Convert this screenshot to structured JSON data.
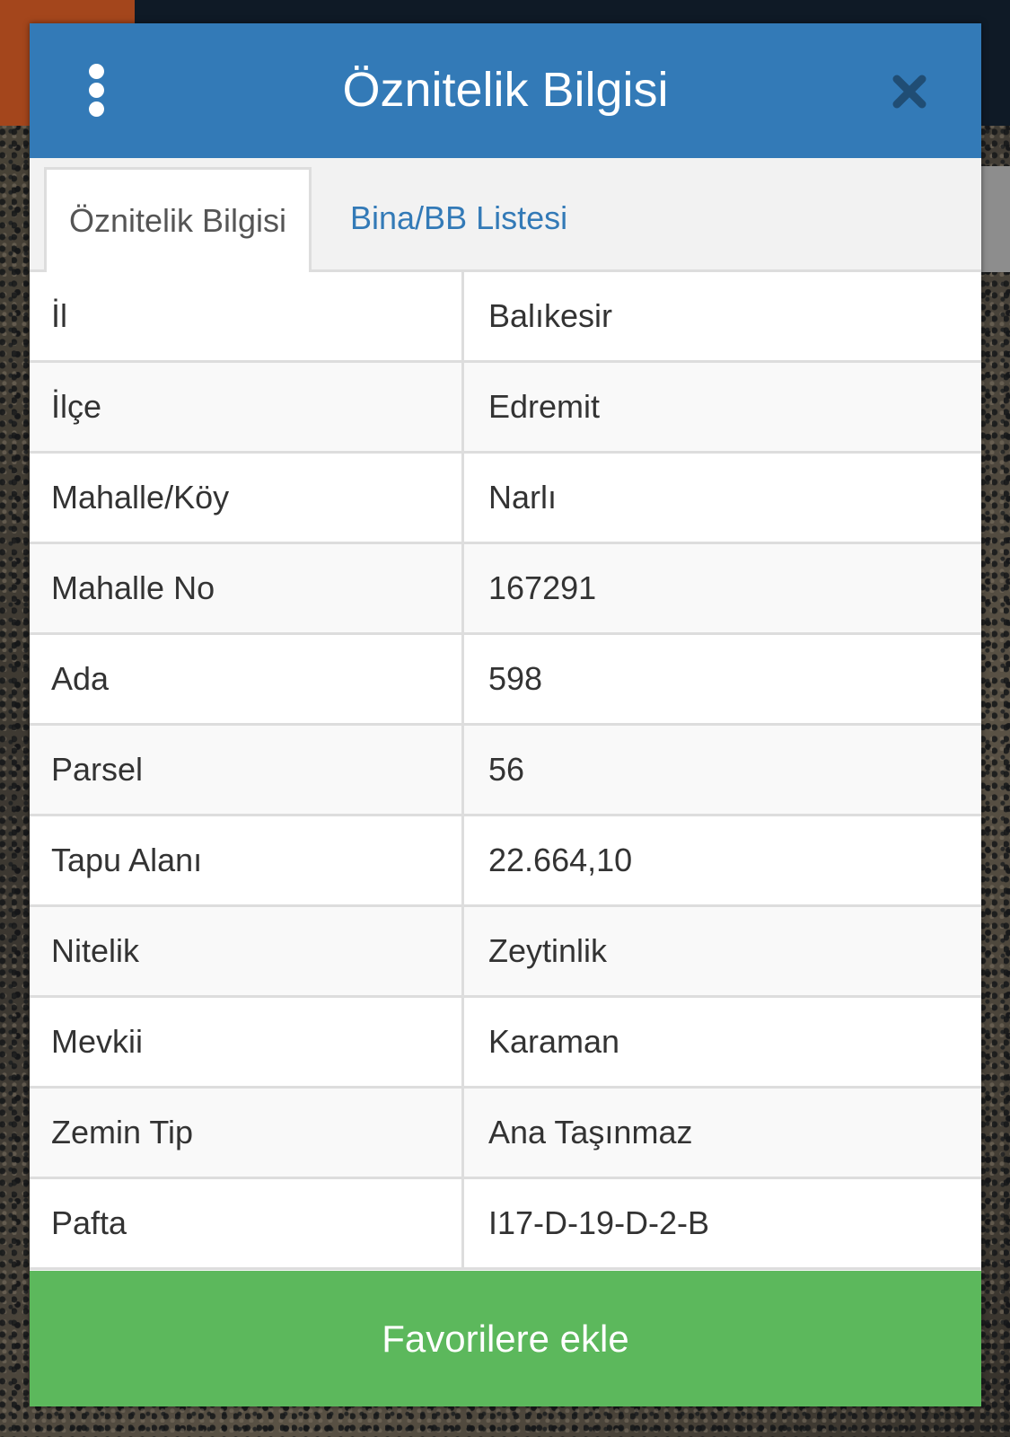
{
  "dialog": {
    "title": "Öznitelik Bilgisi",
    "menu_icon": "kebab-menu-icon",
    "close_icon": "close-icon"
  },
  "tabs": [
    {
      "label": "Öznitelik Bilgisi",
      "active": true
    },
    {
      "label": "Bina/BB Listesi",
      "active": false
    }
  ],
  "attributes": [
    {
      "key": "İl",
      "value": "Balıkesir"
    },
    {
      "key": "İlçe",
      "value": "Edremit"
    },
    {
      "key": "Mahalle/Köy",
      "value": "Narlı"
    },
    {
      "key": "Mahalle No",
      "value": "167291"
    },
    {
      "key": "Ada",
      "value": "598"
    },
    {
      "key": "Parsel",
      "value": "56"
    },
    {
      "key": "Tapu Alanı",
      "value": "22.664,10"
    },
    {
      "key": "Nitelik",
      "value": "Zeytinlik"
    },
    {
      "key": "Mevkii",
      "value": "Karaman"
    },
    {
      "key": "Zemin Tip",
      "value": "Ana Taşınmaz"
    },
    {
      "key": "Pafta",
      "value": "I17-D-19-D-2-B"
    }
  ],
  "footer": {
    "favorite_label": "Favorilere ekle"
  },
  "colors": {
    "header": "#337ab7",
    "link": "#337ab7",
    "favorite_button": "#5cb85c"
  }
}
